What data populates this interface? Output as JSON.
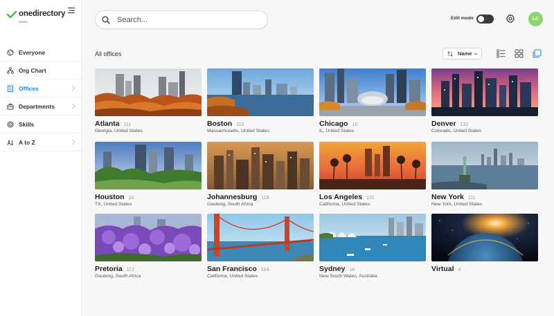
{
  "brand": {
    "name": "onedirectory",
    "sub": "DEMO"
  },
  "nav": [
    {
      "label": "Everyone",
      "icon": "globe-icon"
    },
    {
      "label": "Org Chart",
      "icon": "org-chart-icon"
    },
    {
      "label": "Offices",
      "icon": "office-icon",
      "active": true
    },
    {
      "label": "Departments",
      "icon": "departments-icon"
    },
    {
      "label": "Skills",
      "icon": "skills-icon"
    },
    {
      "label": "A to Z",
      "icon": "a-to-z-icon"
    }
  ],
  "search": {
    "placeholder": "Search..."
  },
  "topbar": {
    "edit_mode_label": "Edit mode",
    "avatar_initials": "LC"
  },
  "section": {
    "title": "All offices",
    "sort_label": "Name"
  },
  "colors": {
    "accent": "#1e88d8",
    "avatar": "#8bd66b"
  },
  "offices": [
    {
      "city": "Atlanta",
      "count": "111",
      "location": "Georgia, United States"
    },
    {
      "city": "Boston",
      "count": "110",
      "location": "Massachusetts, United States"
    },
    {
      "city": "Chicago",
      "count": "10",
      "location": "IL, United States"
    },
    {
      "city": "Denver",
      "count": "132",
      "location": "Colorado, United States"
    },
    {
      "city": "Houston",
      "count": "24",
      "location": "TX, United States"
    },
    {
      "city": "Johannesburg",
      "count": "118",
      "location": "Gauteng, South Africa"
    },
    {
      "city": "Los Angeles",
      "count": "131",
      "location": "California, United States"
    },
    {
      "city": "New York",
      "count": "111",
      "location": "New York, United States"
    },
    {
      "city": "Pretoria",
      "count": "112",
      "location": "Gauteng, South Africa"
    },
    {
      "city": "San Francisco",
      "count": "104",
      "location": "California, United States"
    },
    {
      "city": "Sydney",
      "count": "18",
      "location": "New South Wales, Australia"
    },
    {
      "city": "Virtual",
      "count": "4",
      "location": ""
    }
  ]
}
